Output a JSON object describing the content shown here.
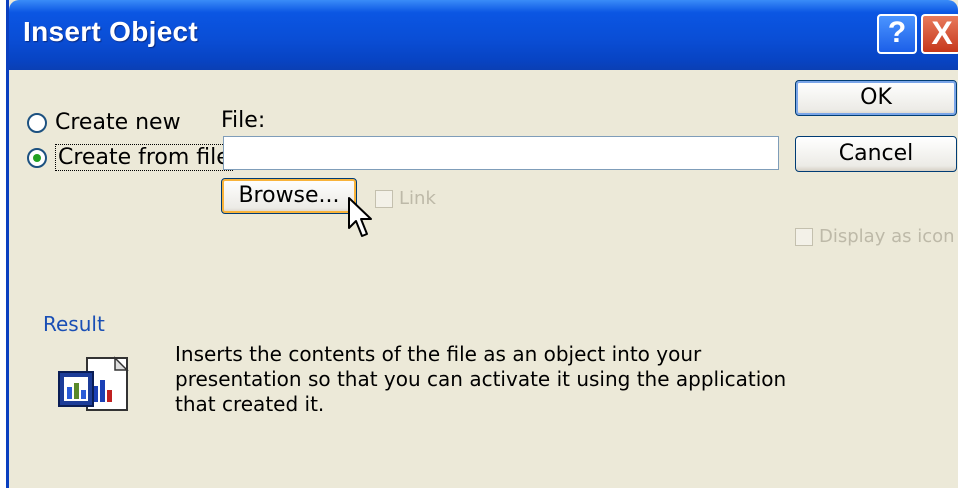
{
  "window": {
    "title": "Insert Object"
  },
  "titlebar": {
    "help_symbol": "?",
    "close_symbol": "X"
  },
  "options": {
    "create_new": "Create new",
    "create_from_file": "Create from file",
    "selected": "create_from_file"
  },
  "file": {
    "label": "File:",
    "value": ""
  },
  "buttons": {
    "ok": "OK",
    "cancel": "Cancel",
    "browse": "Browse..."
  },
  "checkboxes": {
    "link": "Link",
    "display_as_icon": "Display as icon"
  },
  "result": {
    "heading": "Result",
    "description": "Inserts the contents of the file as an object into your presentation so that you can activate it using the application that created it."
  },
  "colors": {
    "title_bar": "#0a4ed6",
    "dialog_bg": "#ece9d8",
    "result_label": "#1a4fb5",
    "selected_radio": "#21a121"
  },
  "icons": [
    "help-icon",
    "close-icon",
    "object-document-icon",
    "mouse-pointer-icon"
  ]
}
